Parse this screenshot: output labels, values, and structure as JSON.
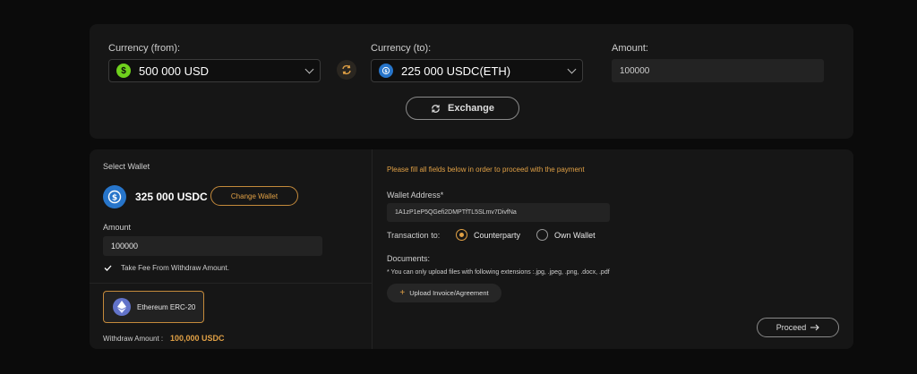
{
  "exchange": {
    "from_label": "Currency (from):",
    "from_value": "500 000 USD",
    "to_label": "Currency (to):",
    "to_value": "225 000 USDC(ETH)",
    "amount_label": "Amount:",
    "amount_value": "100000",
    "exchange_button": "Exchange"
  },
  "wallet": {
    "select_label": "Select Wallet",
    "balance": "325 000 USDC",
    "change_button": "Change Wallet",
    "amount_label": "Amount",
    "amount_value": "100000",
    "fee_checkbox_label": "Take Fee From Withdraw Amount.",
    "fee_checked": true,
    "network": "Ethereum ERC-20",
    "withdraw_label": "Withdraw Amount :",
    "withdraw_value": "100,000 USDC"
  },
  "payment": {
    "notice": "Please fill all fields below in order to proceed with the payment",
    "address_label": "Wallet Address*",
    "address_value": "1A1zP1eP5QGefi2DMPTfTL5SLmv7DivfNa",
    "transaction_label": "Transaction to:",
    "options": [
      "Counterparty",
      "Own Wallet"
    ],
    "selected_option": "Counterparty",
    "documents_label": "Documents:",
    "documents_note": "*  You can only upload files with following extensions :.jpg, .jpeg, .png, .docx, .pdf",
    "upload_button": "Upload Invoice/Agreement",
    "proceed_button": "Proceed"
  },
  "colors": {
    "accent": "#e0a045",
    "usd_coin": "#6fd11d",
    "usdc_coin": "#2775ca",
    "eth_coin": "#6273c9"
  },
  "icons": {
    "swap": "swap-icon",
    "refresh": "refresh-icon",
    "arrow": "arrow-right-icon",
    "plus": "plus-icon",
    "check": "check-icon"
  }
}
